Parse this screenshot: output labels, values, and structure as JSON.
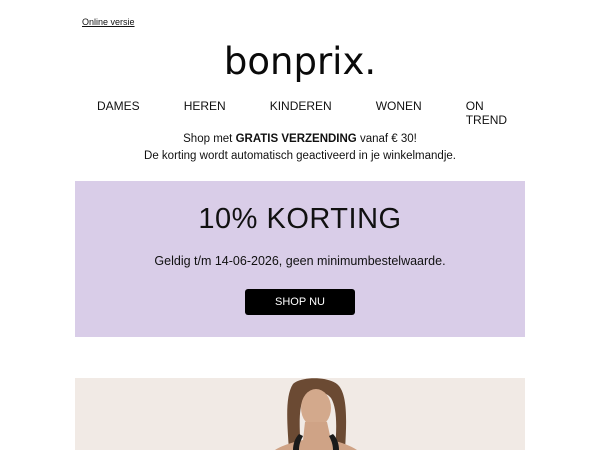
{
  "header": {
    "online_link": "Online versie",
    "logo_text": "bonprix."
  },
  "nav": {
    "items": [
      "DAMES",
      "HEREN",
      "KINDEREN",
      "WONEN",
      "ON TREND"
    ]
  },
  "notice": {
    "line1_prefix": "Shop met ",
    "line1_bold": "GRATIS VERZENDING",
    "line1_suffix": " vanaf € 30!",
    "line2": "De korting wordt automatisch geactiveerd in je winkelmandje."
  },
  "promo": {
    "title": "10% KORTING",
    "subtitle": "Geldig t/m 14-06-2026, geen minimumbestelwaarde.",
    "button_label": "SHOP NU",
    "background": "#d9cde8"
  }
}
